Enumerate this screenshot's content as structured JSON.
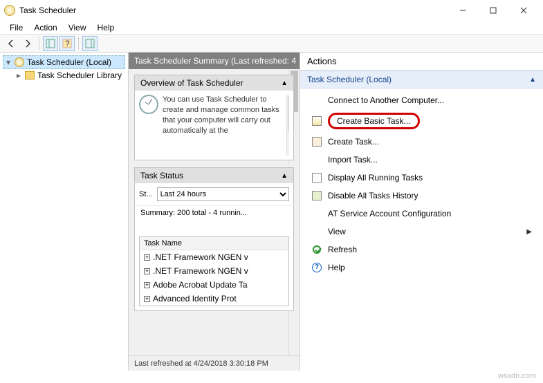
{
  "title": "Task Scheduler",
  "menu": [
    "File",
    "Action",
    "View",
    "Help"
  ],
  "tree": {
    "root": "Task Scheduler (Local)",
    "child": "Task Scheduler Library"
  },
  "middle": {
    "header": "Task Scheduler Summary (Last refreshed: 4",
    "overview": {
      "title": "Overview of Task Scheduler",
      "text": "You can use Task Scheduler to create and manage common tasks that your computer will carry out automatically at the"
    },
    "status": {
      "title": "Task Status",
      "label": "St...",
      "select": "Last 24 hours",
      "summary": "Summary: 200 total - 4 runnin..."
    },
    "tasks": {
      "header": "Task Name",
      "rows": [
        ".NET Framework NGEN v",
        ".NET Framework NGEN v",
        "Adobe Acrobat Update Ta",
        "Advanced Identity Prot"
      ]
    },
    "footer": "Last refreshed at 4/24/2018 3:30:18 PM"
  },
  "actions": {
    "title": "Actions",
    "scope": "Task Scheduler (Local)",
    "items": {
      "connect": "Connect to Another Computer...",
      "create_basic": "Create Basic Task...",
      "create": "Create Task...",
      "import": "Import Task...",
      "display_running": "Display All Running Tasks",
      "disable_history": "Disable All Tasks History",
      "at_service": "AT Service Account Configuration",
      "view": "View",
      "refresh": "Refresh",
      "help": "Help"
    }
  },
  "watermark": "wsxdn.com"
}
